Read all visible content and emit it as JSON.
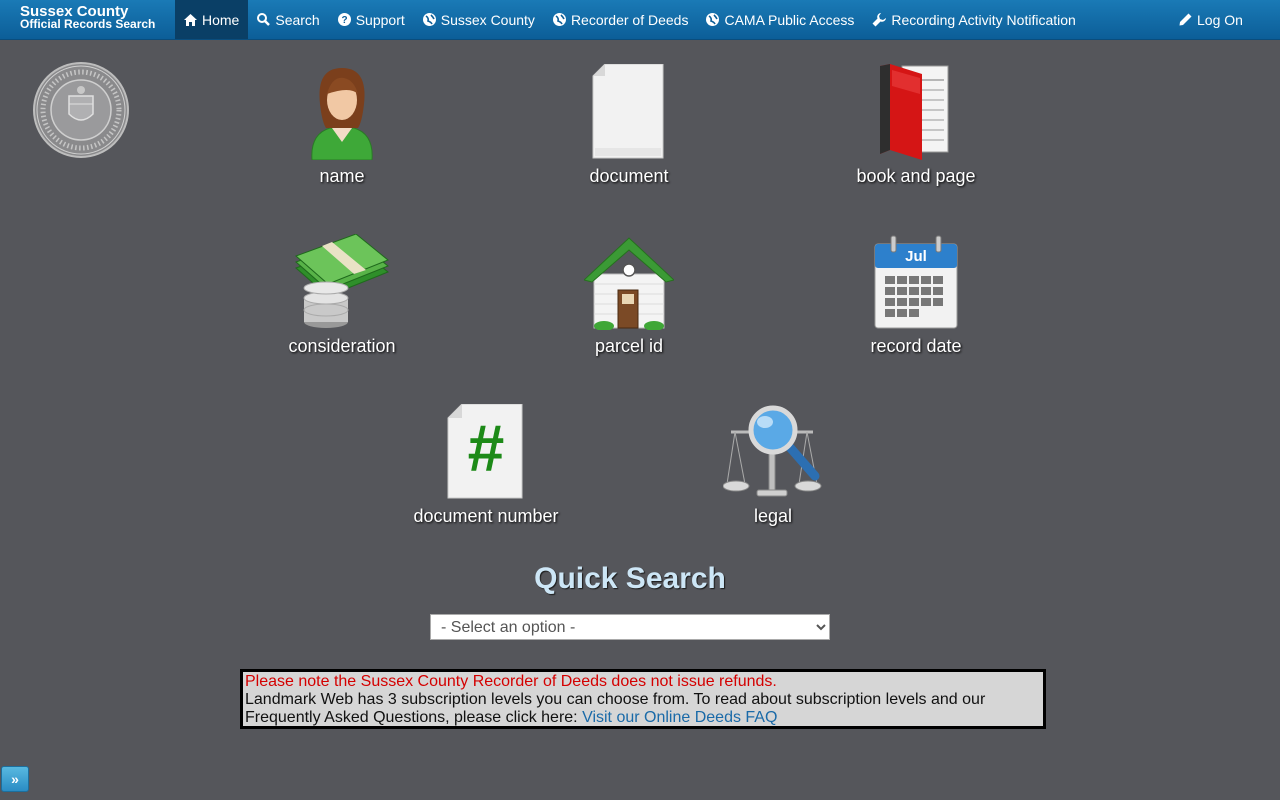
{
  "brand": {
    "line1": "Sussex County",
    "line2": "Official Records Search"
  },
  "nav": {
    "home": "Home",
    "search": "Search",
    "support": "Support",
    "sussex": "Sussex County",
    "recorder": "Recorder of Deeds",
    "cama": "CAMA Public Access",
    "notify": "Recording Activity Notification",
    "logon": "Log On"
  },
  "tiles": {
    "name": "name",
    "document": "document",
    "book_page": "book and page",
    "consideration": "consideration",
    "parcel": "parcel id",
    "record_date": "record date",
    "calendar_month": "Jul",
    "doc_number": "document number",
    "doc_number_glyph": "#",
    "legal": "legal"
  },
  "quick_search": {
    "title": "Quick Search",
    "selected": "- Select an option -"
  },
  "notice": {
    "refund": "Please note the Sussex County Recorder of Deeds does not issue refunds.",
    "body": "Landmark Web has 3 subscription levels you can choose from. To read about subscription levels and our Frequently Asked Questions, please click here: ",
    "link": "Visit our Online Deeds FAQ"
  },
  "toggle": "»",
  "colors": {
    "nav_top": "#1a7ab6",
    "nav_bottom": "#0c5e98",
    "background": "#55565b",
    "title": "#cde6f6",
    "refund": "#d40000",
    "link": "#1a6aa8"
  }
}
